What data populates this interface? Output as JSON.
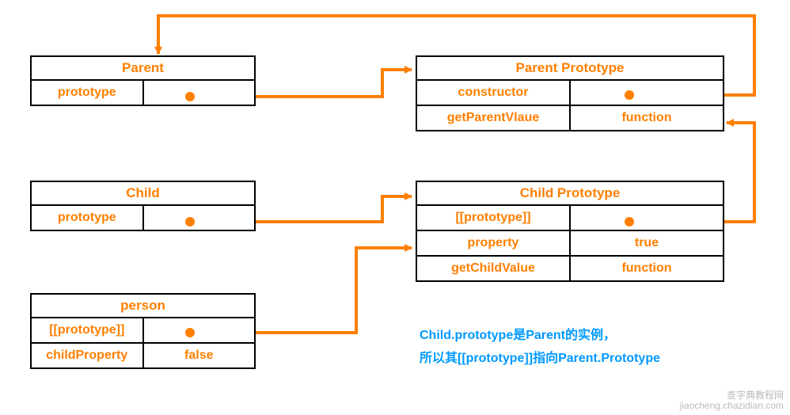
{
  "parent": {
    "title": "Parent",
    "row1_left": "prototype",
    "row1_right": ""
  },
  "parent_proto": {
    "title": "Parent Prototype",
    "row1_left": "constructor",
    "row1_right": "",
    "row2_left": "getParentVlaue",
    "row2_right": "function"
  },
  "child": {
    "title": "Child",
    "row1_left": "prototype",
    "row1_right": ""
  },
  "child_proto": {
    "title": "Child Prototype",
    "row1_left": "[[prototype]]",
    "row1_right": "",
    "row2_left": "property",
    "row2_right": "true",
    "row3_left": "getChildValue",
    "row3_right": "function"
  },
  "person": {
    "title": "person",
    "row1_left": "[[prototype]]",
    "row1_right": "",
    "row2_left": "childProperty",
    "row2_right": "false"
  },
  "note": {
    "line1": "Child.prototype是Parent的实例，",
    "line2": "所以其[[prototype]]指向Parent.Prototype"
  },
  "watermark": {
    "line1": "查字典教程网",
    "line2": "jiaocheng.chazidian.com"
  },
  "chart_data": {
    "type": "diagram",
    "nodes": [
      {
        "id": "Parent",
        "rows": [
          [
            "prototype",
            ""
          ]
        ]
      },
      {
        "id": "Parent Prototype",
        "rows": [
          [
            "constructor",
            ""
          ],
          [
            "getParentVlaue",
            "function"
          ]
        ]
      },
      {
        "id": "Child",
        "rows": [
          [
            "prototype",
            ""
          ]
        ]
      },
      {
        "id": "Child Prototype",
        "rows": [
          [
            "[[prototype]]",
            ""
          ],
          [
            "property",
            "true"
          ],
          [
            "getChildValue",
            "function"
          ]
        ]
      },
      {
        "id": "person",
        "rows": [
          [
            "[[prototype]]",
            ""
          ],
          [
            "childProperty",
            "false"
          ]
        ]
      }
    ],
    "edges": [
      {
        "from": "Parent.prototype",
        "to": "Parent Prototype"
      },
      {
        "from": "Parent Prototype.constructor",
        "to": "Parent"
      },
      {
        "from": "Child.prototype",
        "to": "Child Prototype"
      },
      {
        "from": "Child Prototype.[[prototype]]",
        "to": "Parent Prototype"
      },
      {
        "from": "person.[[prototype]]",
        "to": "Child Prototype"
      }
    ],
    "annotations": [
      "Child.prototype是Parent的实例，所以其[[prototype]]指向Parent.Prototype"
    ]
  }
}
